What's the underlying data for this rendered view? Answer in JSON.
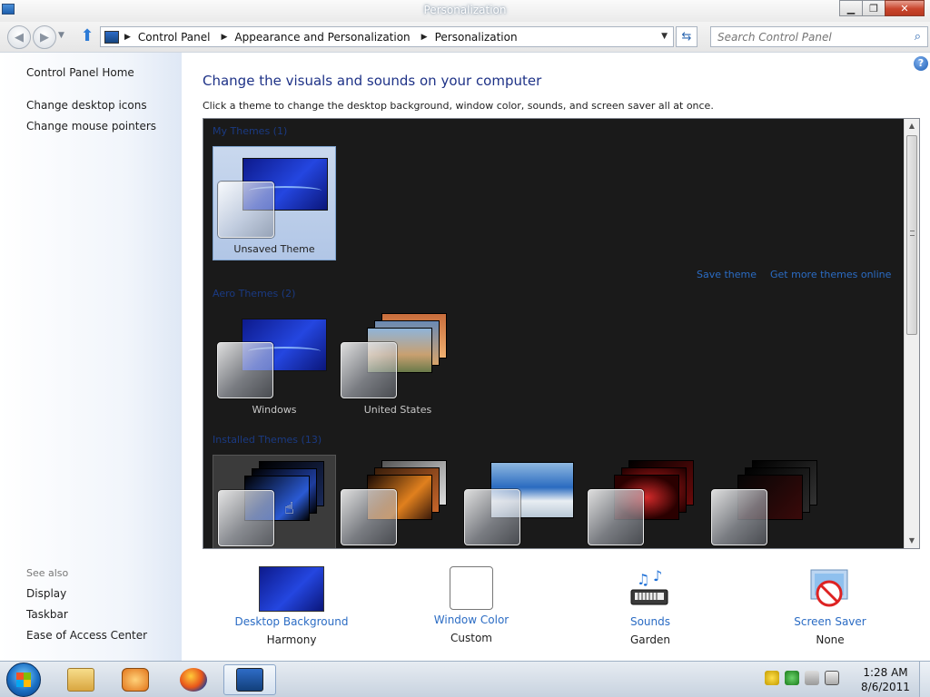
{
  "window": {
    "title": "Personalization"
  },
  "address": {
    "crumbs": [
      "Control Panel",
      "Appearance and Personalization",
      "Personalization"
    ],
    "search_placeholder": "Search Control Panel"
  },
  "sidebar": {
    "links": [
      "Control Panel Home",
      "Change desktop icons",
      "Change mouse pointers"
    ],
    "see_also_label": "See also",
    "see_also": [
      "Display",
      "Taskbar",
      "Ease of Access Center"
    ]
  },
  "main": {
    "heading": "Change the visuals and sounds on your computer",
    "subheading": "Click a theme to change the desktop background, window color, sounds, and screen saver all at once.",
    "groups": {
      "my_themes": "My Themes (1)",
      "aero_themes": "Aero Themes (2)",
      "installed_themes": "Installed Themes (13)"
    },
    "links": {
      "save_theme": "Save theme",
      "get_more": "Get more themes online"
    },
    "themes": {
      "unsaved": "Unsaved Theme",
      "windows": "Windows",
      "united_states": "United States"
    }
  },
  "options": [
    {
      "link": "Desktop Background",
      "value": "Harmony"
    },
    {
      "link": "Window Color",
      "value": "Custom"
    },
    {
      "link": "Sounds",
      "value": "Garden"
    },
    {
      "link": "Screen Saver",
      "value": "None"
    }
  ],
  "taskbar": {
    "time": "1:28 AM",
    "date": "8/6/2011"
  },
  "icons": {
    "back": "back-arrow-icon",
    "forward": "forward-arrow-icon",
    "up": "up-arrow-icon",
    "refresh": "refresh-icon",
    "search": "search-icon",
    "help": "help-icon"
  },
  "colors": {
    "heading": "#1e3287",
    "link": "#2b6cc4",
    "panel_bg": "#1a1a1a"
  }
}
